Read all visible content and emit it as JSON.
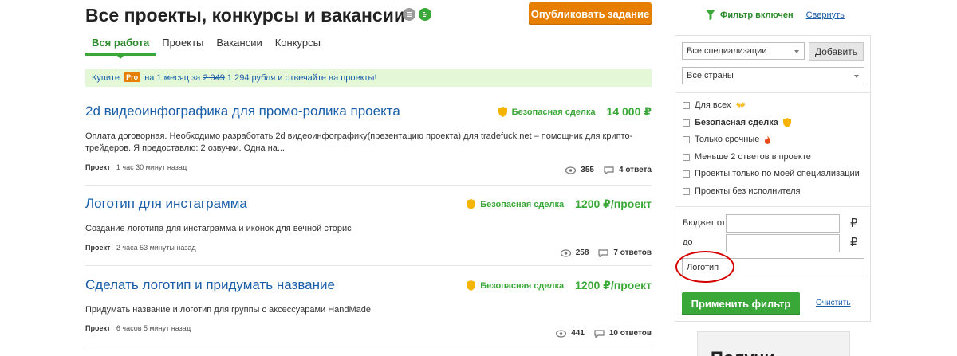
{
  "header": {
    "title": "Все проекты, конкурсы и вакансии",
    "publish_label": "Опубликовать задание"
  },
  "tabs": [
    {
      "label": "Вся работа",
      "active": true
    },
    {
      "label": "Проекты",
      "active": false
    },
    {
      "label": "Вакансии",
      "active": false
    },
    {
      "label": "Конкурсы",
      "active": false
    }
  ],
  "promo": {
    "buy": "Купите",
    "pro": "Pro",
    "period": "на 1 месяц за",
    "old_price": "2 049",
    "new_price": "1 294 рубля и отвечайте на проекты!"
  },
  "projects": [
    {
      "title": "2d видеоинфографика для промо-ролика проекта",
      "safe_label": "Безопасная сделка",
      "price": "14 000 ₽",
      "description": "Оплата договорная. Необходимо разработать 2d видеоинфографику(презентацию проекта) для tradefuck.net – помощник для крипто-трейдеров. Я предоставлю: 2 озвучки. Одна на...",
      "type": "Проект",
      "time": "1 час 30 минут назад",
      "views": "355",
      "answers": "4 ответа"
    },
    {
      "title": "Логотип для инстаграмма",
      "safe_label": "Безопасная сделка",
      "price": "1200 ₽/проект",
      "description": "Создание логотипа для инстаграмма и иконок для вечной сторис",
      "type": "Проект",
      "time": "2 часа 53 минуты назад",
      "views": "258",
      "answers": "7 ответов"
    },
    {
      "title": "Сделать логотип и придумать название",
      "safe_label": "Безопасная сделка",
      "price": "1200 ₽/проект",
      "description": "Придумать название и логотип для группы с аксессуарами HandMade",
      "type": "Проект",
      "time": "6 часов 5 минут назад",
      "views": "441",
      "answers": "10 ответов"
    }
  ],
  "sidebar": {
    "filter_on": "Фильтр включен",
    "collapse": "Свернуть",
    "spec_select": "Все специализации",
    "add_label": "Добавить",
    "country_select": "Все страны",
    "checks": [
      {
        "label": "Для всех",
        "bold": false,
        "emoji": "👐"
      },
      {
        "label": "Безопасная сделка",
        "bold": true,
        "emoji": "shield"
      },
      {
        "label": "Только срочные",
        "bold": false,
        "emoji": "🔥"
      },
      {
        "label": "Меньше 2 ответов в проекте",
        "bold": false,
        "emoji": ""
      },
      {
        "label": "Проекты только по моей специализации",
        "bold": false,
        "emoji": ""
      },
      {
        "label": "Проекты без исполнителя",
        "bold": false,
        "emoji": ""
      }
    ],
    "budget_from": "Бюджет от",
    "budget_to": "до",
    "currency": "₽",
    "keyword_value": "Логотип",
    "apply_label": "Применить фильтр",
    "clear_label": "Очистить",
    "promo_card_title": "Получи"
  },
  "colors": {
    "accent_green": "#3aa838",
    "accent_orange": "#e67e00",
    "link_blue": "#1a5ea8",
    "highlight_red": "#d40000"
  }
}
